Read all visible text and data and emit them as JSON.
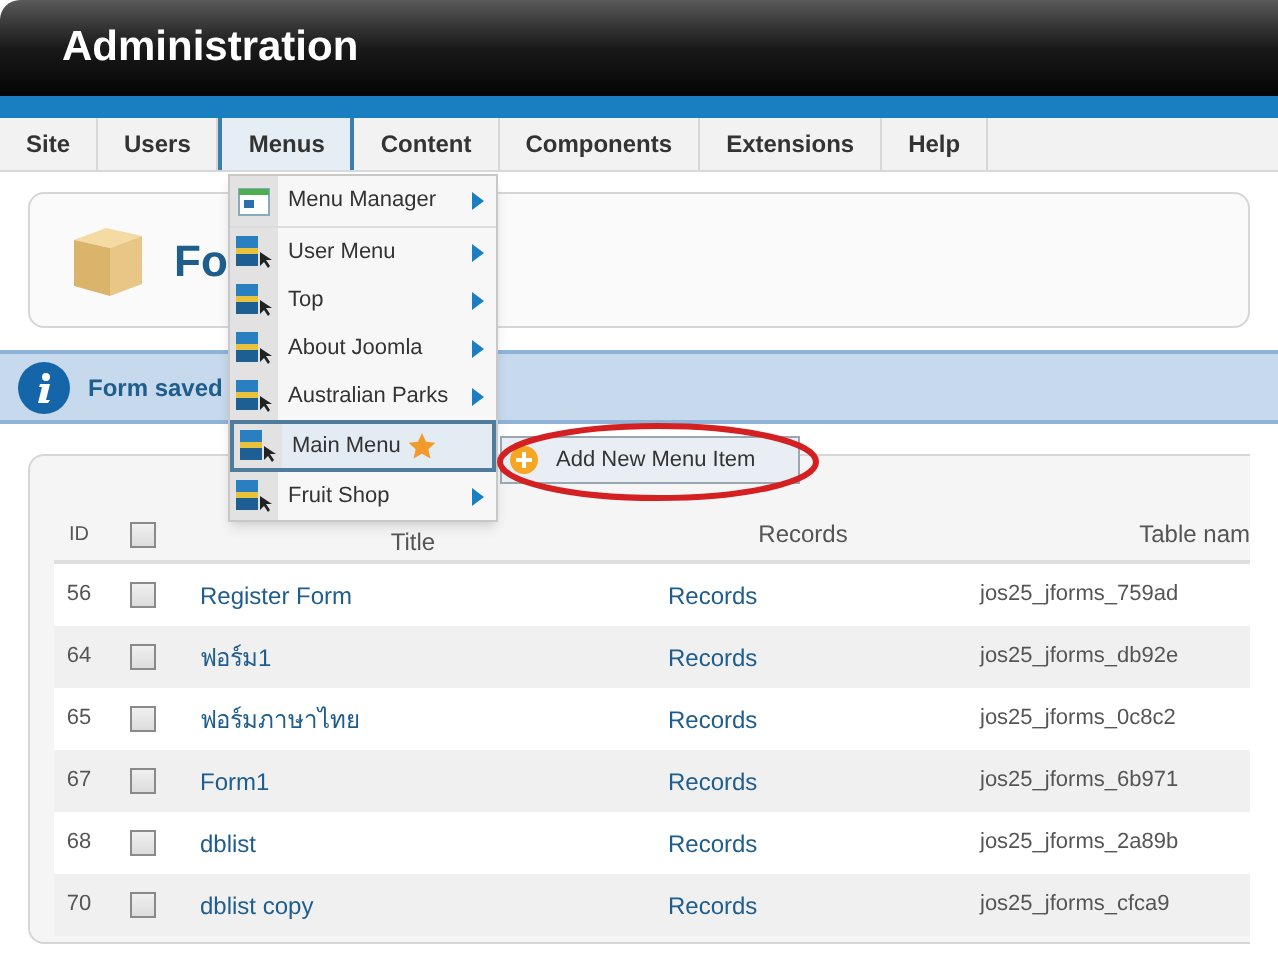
{
  "header": {
    "title": "Administration"
  },
  "nav": [
    {
      "label": "Site",
      "selected": false
    },
    {
      "label": "Users",
      "selected": false
    },
    {
      "label": "Menus",
      "selected": true
    },
    {
      "label": "Content",
      "selected": false
    },
    {
      "label": "Components",
      "selected": false
    },
    {
      "label": "Extensions",
      "selected": false
    },
    {
      "label": "Help",
      "selected": false
    }
  ],
  "toolbar": {
    "title": "Fo"
  },
  "message": {
    "text": "Form saved"
  },
  "menu": [
    {
      "label": "Menu Manager",
      "kind": "manager",
      "has_submenu": true,
      "default": false,
      "selected": false
    },
    {
      "label": "User Menu",
      "kind": "menu",
      "has_submenu": true,
      "default": false,
      "selected": false
    },
    {
      "label": "Top",
      "kind": "menu",
      "has_submenu": true,
      "default": false,
      "selected": false
    },
    {
      "label": "About Joomla",
      "kind": "menu",
      "has_submenu": true,
      "default": false,
      "selected": false
    },
    {
      "label": "Australian Parks",
      "kind": "menu",
      "has_submenu": true,
      "default": false,
      "selected": false
    },
    {
      "label": "Main Menu",
      "kind": "menu",
      "has_submenu": false,
      "default": true,
      "selected": true
    },
    {
      "label": "Fruit Shop",
      "kind": "menu",
      "has_submenu": true,
      "default": false,
      "selected": false
    }
  ],
  "submenu": {
    "label": "Add New Menu Item",
    "circled": true
  },
  "table": {
    "all_checked": false,
    "columns": [
      "ID",
      "Title",
      "Records",
      "Table nam"
    ],
    "rows": [
      {
        "id": "56",
        "checked": false,
        "title": "Register Form",
        "records": "Records",
        "table_name": "jos25_jforms_759ad"
      },
      {
        "id": "64",
        "checked": false,
        "title": "ฟอร์ม1",
        "records": "Records",
        "table_name": "jos25_jforms_db92e"
      },
      {
        "id": "65",
        "checked": false,
        "title": "ฟอร์มภาษาไทย",
        "records": "Records",
        "table_name": "jos25_jforms_0c8c2"
      },
      {
        "id": "67",
        "checked": false,
        "title": "Form1",
        "records": "Records",
        "table_name": "jos25_jforms_6b971"
      },
      {
        "id": "68",
        "checked": false,
        "title": "dblist",
        "records": "Records",
        "table_name": "jos25_jforms_2a89b"
      },
      {
        "id": "70",
        "checked": false,
        "title": "dblist copy",
        "records": "Records",
        "table_name": "jos25_jforms_cfca9"
      }
    ]
  }
}
